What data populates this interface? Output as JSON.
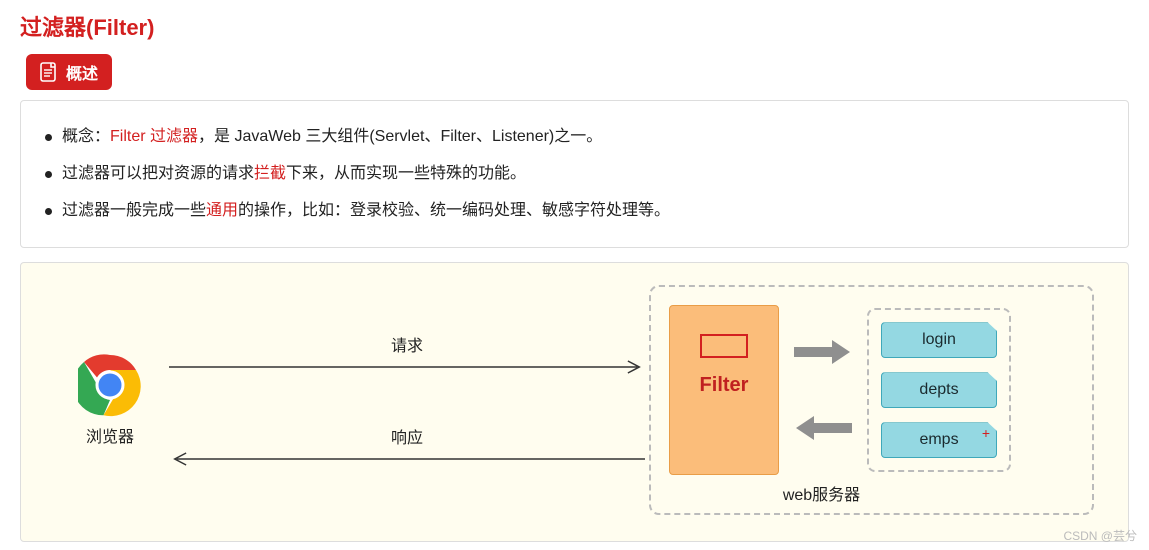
{
  "title": "过滤器(Filter)",
  "badge": {
    "label": "概述"
  },
  "bullets": [
    {
      "prefix": "概念：",
      "red": "Filter 过滤器",
      "suffix": "，是 JavaWeb 三大组件(Servlet、Filter、Listener)之一。"
    },
    {
      "prefix": "过滤器可以把对资源的请求",
      "red": "拦截",
      "suffix": "下来，从而实现一些特殊的功能。"
    },
    {
      "prefix": "过滤器一般完成一些",
      "red": "通用",
      "suffix": "的操作，比如：登录校验、统一编码处理、敏感字符处理等。"
    }
  ],
  "diagram": {
    "browser_label": "浏览器",
    "request_label": "请求",
    "response_label": "响应",
    "filter_label": "Filter",
    "server_label": "web服务器",
    "routes": [
      "login",
      "depts",
      "emps"
    ],
    "colors": {
      "accent": "#d32020",
      "filter_bg": "#fbbd7a",
      "route_bg": "#94d8e2",
      "bg": "#fffdef"
    }
  },
  "watermark": "CSDN @芸兮"
}
